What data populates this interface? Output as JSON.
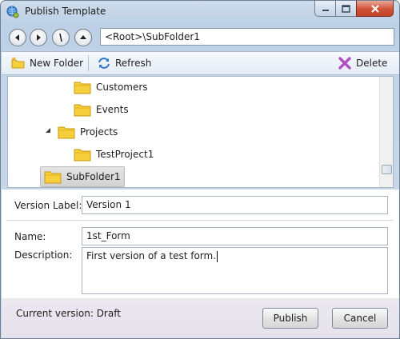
{
  "window": {
    "title": "Publish Template",
    "icons": {
      "app": "globe-gear-icon",
      "minimize": "minimize-icon",
      "maximize": "maximize-icon",
      "close": "close-icon"
    }
  },
  "nav": {
    "address": "<Root>\\SubFolder1",
    "icons": [
      "back-icon",
      "forward-icon",
      "refresh-nav-icon",
      "up-icon"
    ]
  },
  "toolbar": {
    "new_folder": "New Folder",
    "refresh": "Refresh",
    "delete": "Delete"
  },
  "tree": {
    "items": [
      {
        "label": "Customers"
      },
      {
        "label": "Events"
      },
      {
        "label": "Projects"
      },
      {
        "label": "TestProject1"
      },
      {
        "label": "SubFolder1"
      }
    ]
  },
  "form": {
    "version_label_caption": "Version Label:",
    "version_label_value": "Version 1",
    "name_caption": "Name:",
    "name_value": "1st_Form",
    "description_caption": "Description:",
    "description_value": "First version of a test form."
  },
  "footer": {
    "current_version": "Current version: Draft",
    "publish": "Publish",
    "cancel": "Cancel"
  },
  "colors": {
    "folder": "#f5cf3c",
    "close_button": "#cf5236",
    "delete_icon": "#b14fc4",
    "refresh_icon": "#2a78c8"
  }
}
